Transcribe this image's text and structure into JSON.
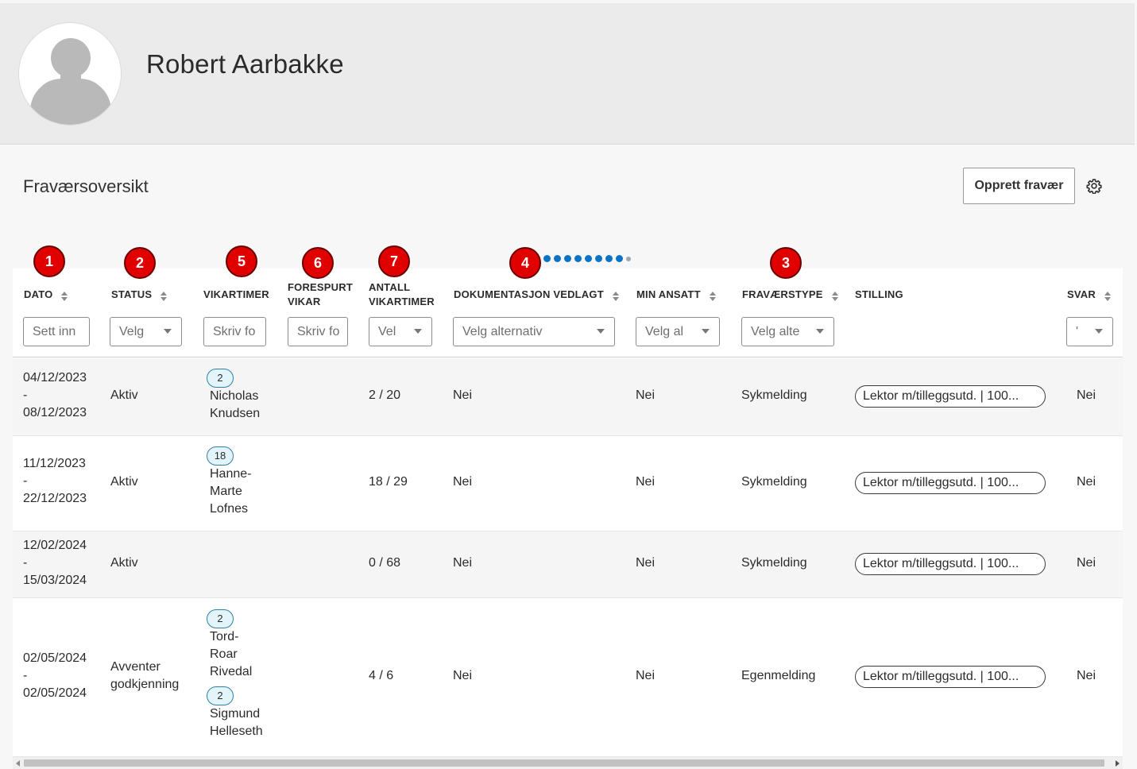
{
  "profile": {
    "name": "Robert Aarbakke",
    "avatar_icon": "user-silhouette-icon"
  },
  "overview": {
    "title": "Fraværsoversikt",
    "create_button": "Opprett fravær",
    "settings_icon": "gear-icon"
  },
  "markers": [
    "1",
    "2",
    "5",
    "6",
    "7",
    "4",
    "3"
  ],
  "columns": {
    "dato": {
      "label": "DATO",
      "filter": "Sett inn"
    },
    "status": {
      "label": "STATUS",
      "filter": "Velg"
    },
    "vikartimer": {
      "label": "VIKARTIMER",
      "filter": "Skriv fo"
    },
    "forespurt": {
      "label_1": "FORESPURT",
      "label_2": "VIKAR",
      "filter": "Skriv fo"
    },
    "antall": {
      "label_1": "ANTALL",
      "label_2": "VIKARTIMER",
      "filter": "Vel"
    },
    "dokumentasjon": {
      "label": "DOKUMENTASJON VEDLAGT",
      "filter": "Velg alternativ"
    },
    "min_ansatt": {
      "label": "MIN ANSATT",
      "filter": "Velg al"
    },
    "fravaerstype": {
      "label": "FRAVÆRSTYPE",
      "filter": "Velg alte"
    },
    "stilling": {
      "label": "STILLING"
    },
    "svar": {
      "label": "SVAR",
      "filter": "'"
    }
  },
  "rows": [
    {
      "date_from": "04/12/2023",
      "date_sep": "-",
      "date_to": "08/12/2023",
      "status": "Aktiv",
      "vikarer": [
        {
          "hours": "2",
          "name": "Nicholas Knudsen"
        }
      ],
      "antall": "2 / 20",
      "dokumentasjon": "Nei",
      "min_ansatt": "Nei",
      "fravaerstype": "Sykmelding",
      "stilling": "Lektor m/tilleggsutd. | 100...",
      "svar": "Nei"
    },
    {
      "date_from": "11/12/2023",
      "date_sep": "-",
      "date_to": "22/12/2023",
      "status": "Aktiv",
      "vikarer": [
        {
          "hours": "18",
          "name": "Hanne-Marte Lofnes"
        }
      ],
      "antall": "18 / 29",
      "dokumentasjon": "Nei",
      "min_ansatt": "Nei",
      "fravaerstype": "Sykmelding",
      "stilling": "Lektor m/tilleggsutd. | 100...",
      "svar": "Nei"
    },
    {
      "date_from": "12/02/2024",
      "date_sep": "-",
      "date_to": "15/03/2024",
      "status": "Aktiv",
      "vikarer": [],
      "antall": "0 / 68",
      "dokumentasjon": "Nei",
      "min_ansatt": "Nei",
      "fravaerstype": "Sykmelding",
      "stilling": "Lektor m/tilleggsutd. | 100...",
      "svar": "Nei"
    },
    {
      "date_from": "02/05/2024",
      "date_sep": "-",
      "date_to": "02/05/2024",
      "status": "Avventer godkjenning",
      "vikarer": [
        {
          "hours": "2",
          "name": "Tord-Roar Rivedal"
        },
        {
          "hours": "2",
          "name": "Sigmund Helleseth"
        }
      ],
      "antall": "4 / 6",
      "dokumentasjon": "Nei",
      "min_ansatt": "Nei",
      "fravaerstype": "Egenmelding",
      "stilling": "Lektor m/tilleggsutd. | 100...",
      "svar": "Nei"
    }
  ]
}
